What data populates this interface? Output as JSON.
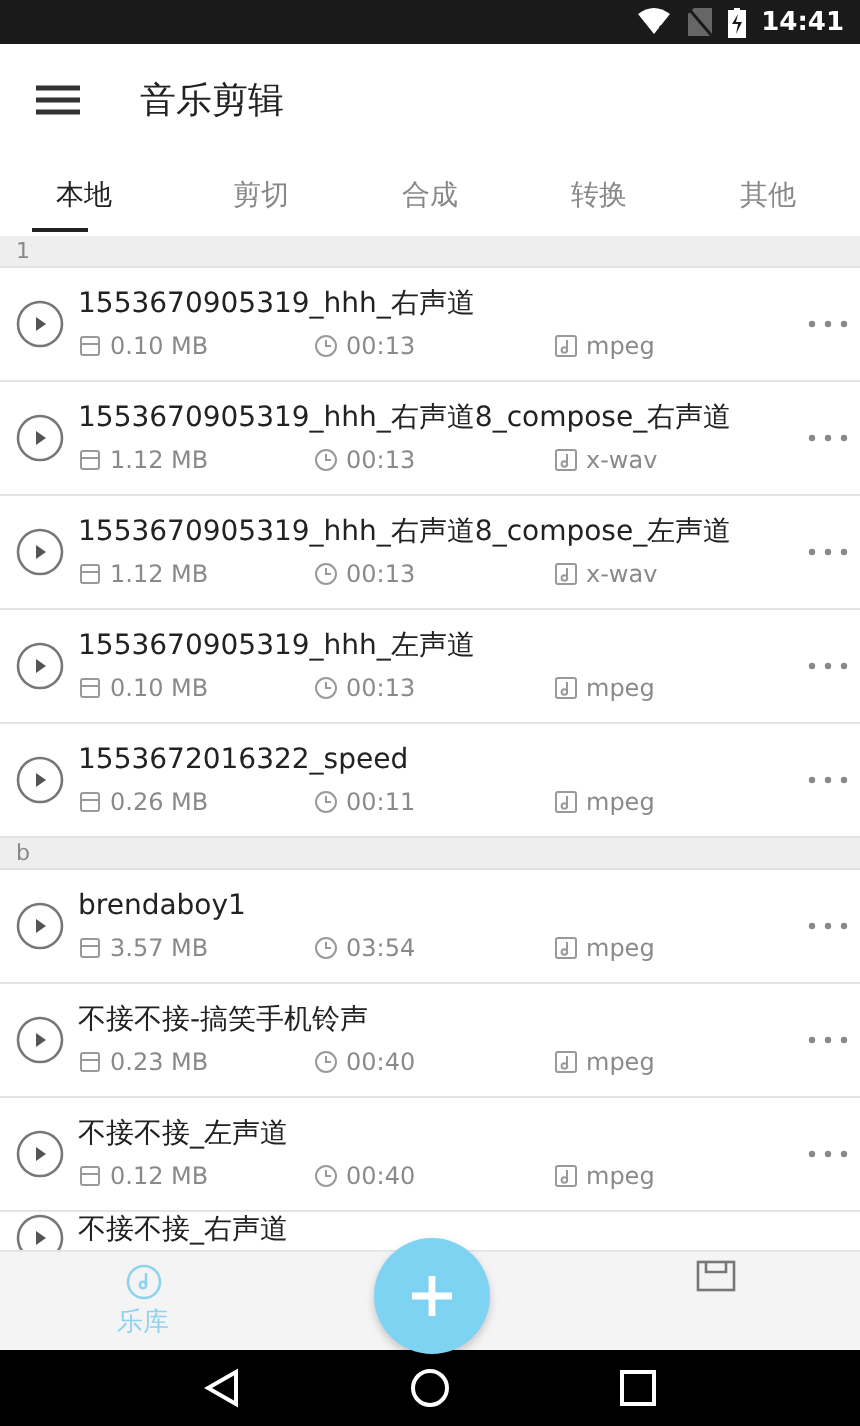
{
  "status_bar": {
    "time": "14:41"
  },
  "app_bar": {
    "title": "音乐剪辑"
  },
  "tabs": [
    {
      "label": "本地",
      "selected": true
    },
    {
      "label": "剪切",
      "selected": false
    },
    {
      "label": "合成",
      "selected": false
    },
    {
      "label": "转换",
      "selected": false
    },
    {
      "label": "其他",
      "selected": false
    }
  ],
  "sections": [
    {
      "header": "1",
      "items": [
        {
          "name": "1553670905319_hhh_右声道",
          "size": "0.10 MB",
          "duration": "00:13",
          "format": "mpeg"
        },
        {
          "name": "1553670905319_hhh_右声道8_compose_右声道",
          "size": "1.12 MB",
          "duration": "00:13",
          "format": "x-wav"
        },
        {
          "name": "1553670905319_hhh_右声道8_compose_左声道",
          "size": "1.12 MB",
          "duration": "00:13",
          "format": "x-wav"
        },
        {
          "name": "1553670905319_hhh_左声道",
          "size": "0.10 MB",
          "duration": "00:13",
          "format": "mpeg"
        },
        {
          "name": "1553672016322_speed",
          "size": "0.26 MB",
          "duration": "00:11",
          "format": "mpeg"
        }
      ]
    },
    {
      "header": "b",
      "items": [
        {
          "name": "brendaboy1",
          "size": "3.57 MB",
          "duration": "03:54",
          "format": "mpeg"
        },
        {
          "name": "不接不接-搞笑手机铃声",
          "size": "0.23 MB",
          "duration": "00:40",
          "format": "mpeg"
        },
        {
          "name": "不接不接_左声道",
          "size": "0.12 MB",
          "duration": "00:40",
          "format": "mpeg"
        },
        {
          "name": "不接不接_右声道"
        }
      ]
    }
  ],
  "bottom_nav": [
    {
      "kind": "library",
      "label": "乐库",
      "selected": true
    },
    {
      "kind": "add"
    },
    {
      "kind": "saved",
      "selected": false
    }
  ]
}
